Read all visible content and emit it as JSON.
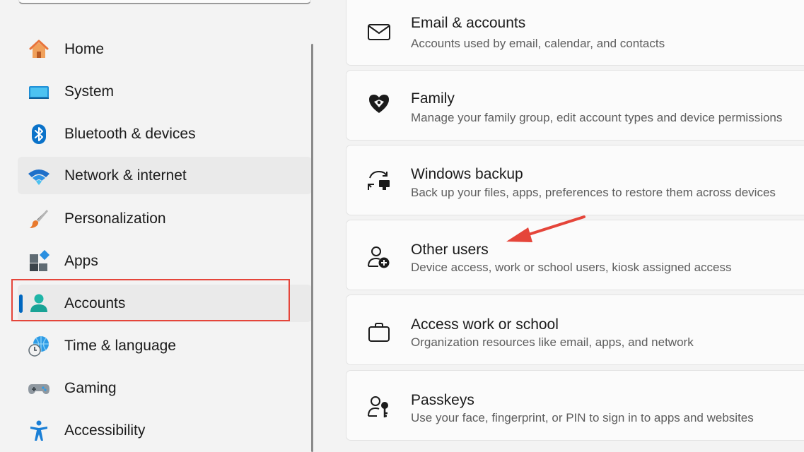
{
  "sidebar": {
    "items": [
      {
        "label": "Home",
        "icon": "home-icon"
      },
      {
        "label": "System",
        "icon": "system-monitor-icon"
      },
      {
        "label": "Bluetooth & devices",
        "icon": "bluetooth-icon"
      },
      {
        "label": "Network & internet",
        "icon": "wifi-icon"
      },
      {
        "label": "Personalization",
        "icon": "paintbrush-icon"
      },
      {
        "label": "Apps",
        "icon": "apps-icon"
      },
      {
        "label": "Accounts",
        "icon": "user-icon"
      },
      {
        "label": "Time & language",
        "icon": "clock-globe-icon"
      },
      {
        "label": "Gaming",
        "icon": "gamepad-icon"
      },
      {
        "label": "Accessibility",
        "icon": "accessibility-icon"
      }
    ],
    "selected": "Accounts"
  },
  "main": {
    "cards": [
      {
        "title": "Email & accounts",
        "description": "Accounts used by email, calendar, and contacts",
        "icon": "mail-icon"
      },
      {
        "title": "Family",
        "description": "Manage your family group, edit account types and device permissions",
        "icon": "family-heart-icon"
      },
      {
        "title": "Windows backup",
        "description": "Back up your files, apps, preferences to restore them across devices",
        "icon": "backup-sync-icon"
      },
      {
        "title": "Other users",
        "description": "Device access, work or school users, kiosk assigned access",
        "icon": "add-user-icon"
      },
      {
        "title": "Access work or school",
        "description": "Organization resources like email, apps, and network",
        "icon": "briefcase-icon"
      },
      {
        "title": "Passkeys",
        "description": "Use your face, fingerprint, or PIN to sign in to apps and websites",
        "icon": "passkey-icon"
      }
    ]
  },
  "colors": {
    "accent": "#0067c0",
    "annotation": "#e5453a"
  }
}
